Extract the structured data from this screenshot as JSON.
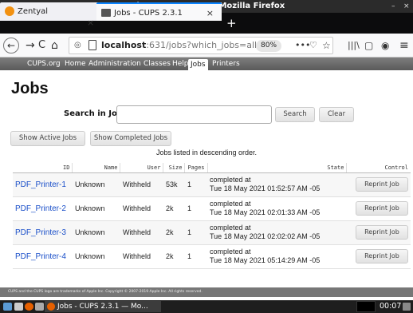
{
  "window": {
    "title": "Jobs - CUPS 2.3.1 — Mozilla Firefox",
    "controls": [
      "–",
      "×"
    ]
  },
  "tabs": [
    {
      "label": "Zentyal",
      "close": "×"
    },
    {
      "label": "Jobs - CUPS 2.3.1",
      "close": "×"
    }
  ],
  "new_tab_label": "+",
  "nav": {
    "back": "←",
    "forward": "→",
    "reload": "C",
    "home": "⌂",
    "url_host": "localhost",
    "url_rest": ":631/jobs?which_jobs=all",
    "zoom": "80%",
    "more": "•••",
    "pocket": "♡",
    "star": "☆",
    "library": "|||\\",
    "sidebar": "▢",
    "extension": "◉",
    "menu": "≡"
  },
  "cups_nav": [
    "CUPS.org",
    "Home",
    "Administration",
    "Classes",
    "Help",
    "Jobs",
    "Printers"
  ],
  "cups_nav_active": "Jobs",
  "page": {
    "title": "Jobs",
    "search_label": "Search in Jobs:",
    "search_value": "",
    "search_button": "Search",
    "clear_button": "Clear",
    "show_active_button": "Show Active Jobs",
    "show_completed_button": "Show Completed Jobs",
    "listed_note": "Jobs listed in descending order."
  },
  "table": {
    "headers": [
      "ID",
      "Name",
      "User",
      "Size",
      "Pages",
      "State",
      "Control"
    ],
    "rows": [
      {
        "id": "PDF_Printer-1",
        "name": "Unknown",
        "user": "Withheld",
        "size": "53k",
        "pages": "1",
        "state_line1": "completed at",
        "state_line2": "Tue 18 May 2021 01:52:57 AM -05",
        "control": "Reprint Job"
      },
      {
        "id": "PDF_Printer-2",
        "name": "Unknown",
        "user": "Withheld",
        "size": "2k",
        "pages": "1",
        "state_line1": "completed at",
        "state_line2": "Tue 18 May 2021 02:01:33 AM -05",
        "control": "Reprint Job"
      },
      {
        "id": "PDF_Printer-3",
        "name": "Unknown",
        "user": "Withheld",
        "size": "2k",
        "pages": "1",
        "state_line1": "completed at",
        "state_line2": "Tue 18 May 2021 02:02:02 AM -05",
        "control": "Reprint Job"
      },
      {
        "id": "PDF_Printer-4",
        "name": "Unknown",
        "user": "Withheld",
        "size": "2k",
        "pages": "1",
        "state_line1": "completed at",
        "state_line2": "Tue 18 May 2021 05:14:29 AM -05",
        "control": "Reprint Job"
      }
    ]
  },
  "footer_note": "CUPS and the CUPS logo are trademarks of Apple Inc. Copyright © 2007-2019 Apple Inc. All rights reserved.",
  "taskbar": {
    "window_label": "Jobs - CUPS 2.3.1 — Mo...",
    "clock": "00:07"
  },
  "colors": {
    "accent": "#0a84ff",
    "link": "#1a4fc9",
    "cups_header": "#6b6b6b",
    "firefox_orange": "#e66000"
  }
}
